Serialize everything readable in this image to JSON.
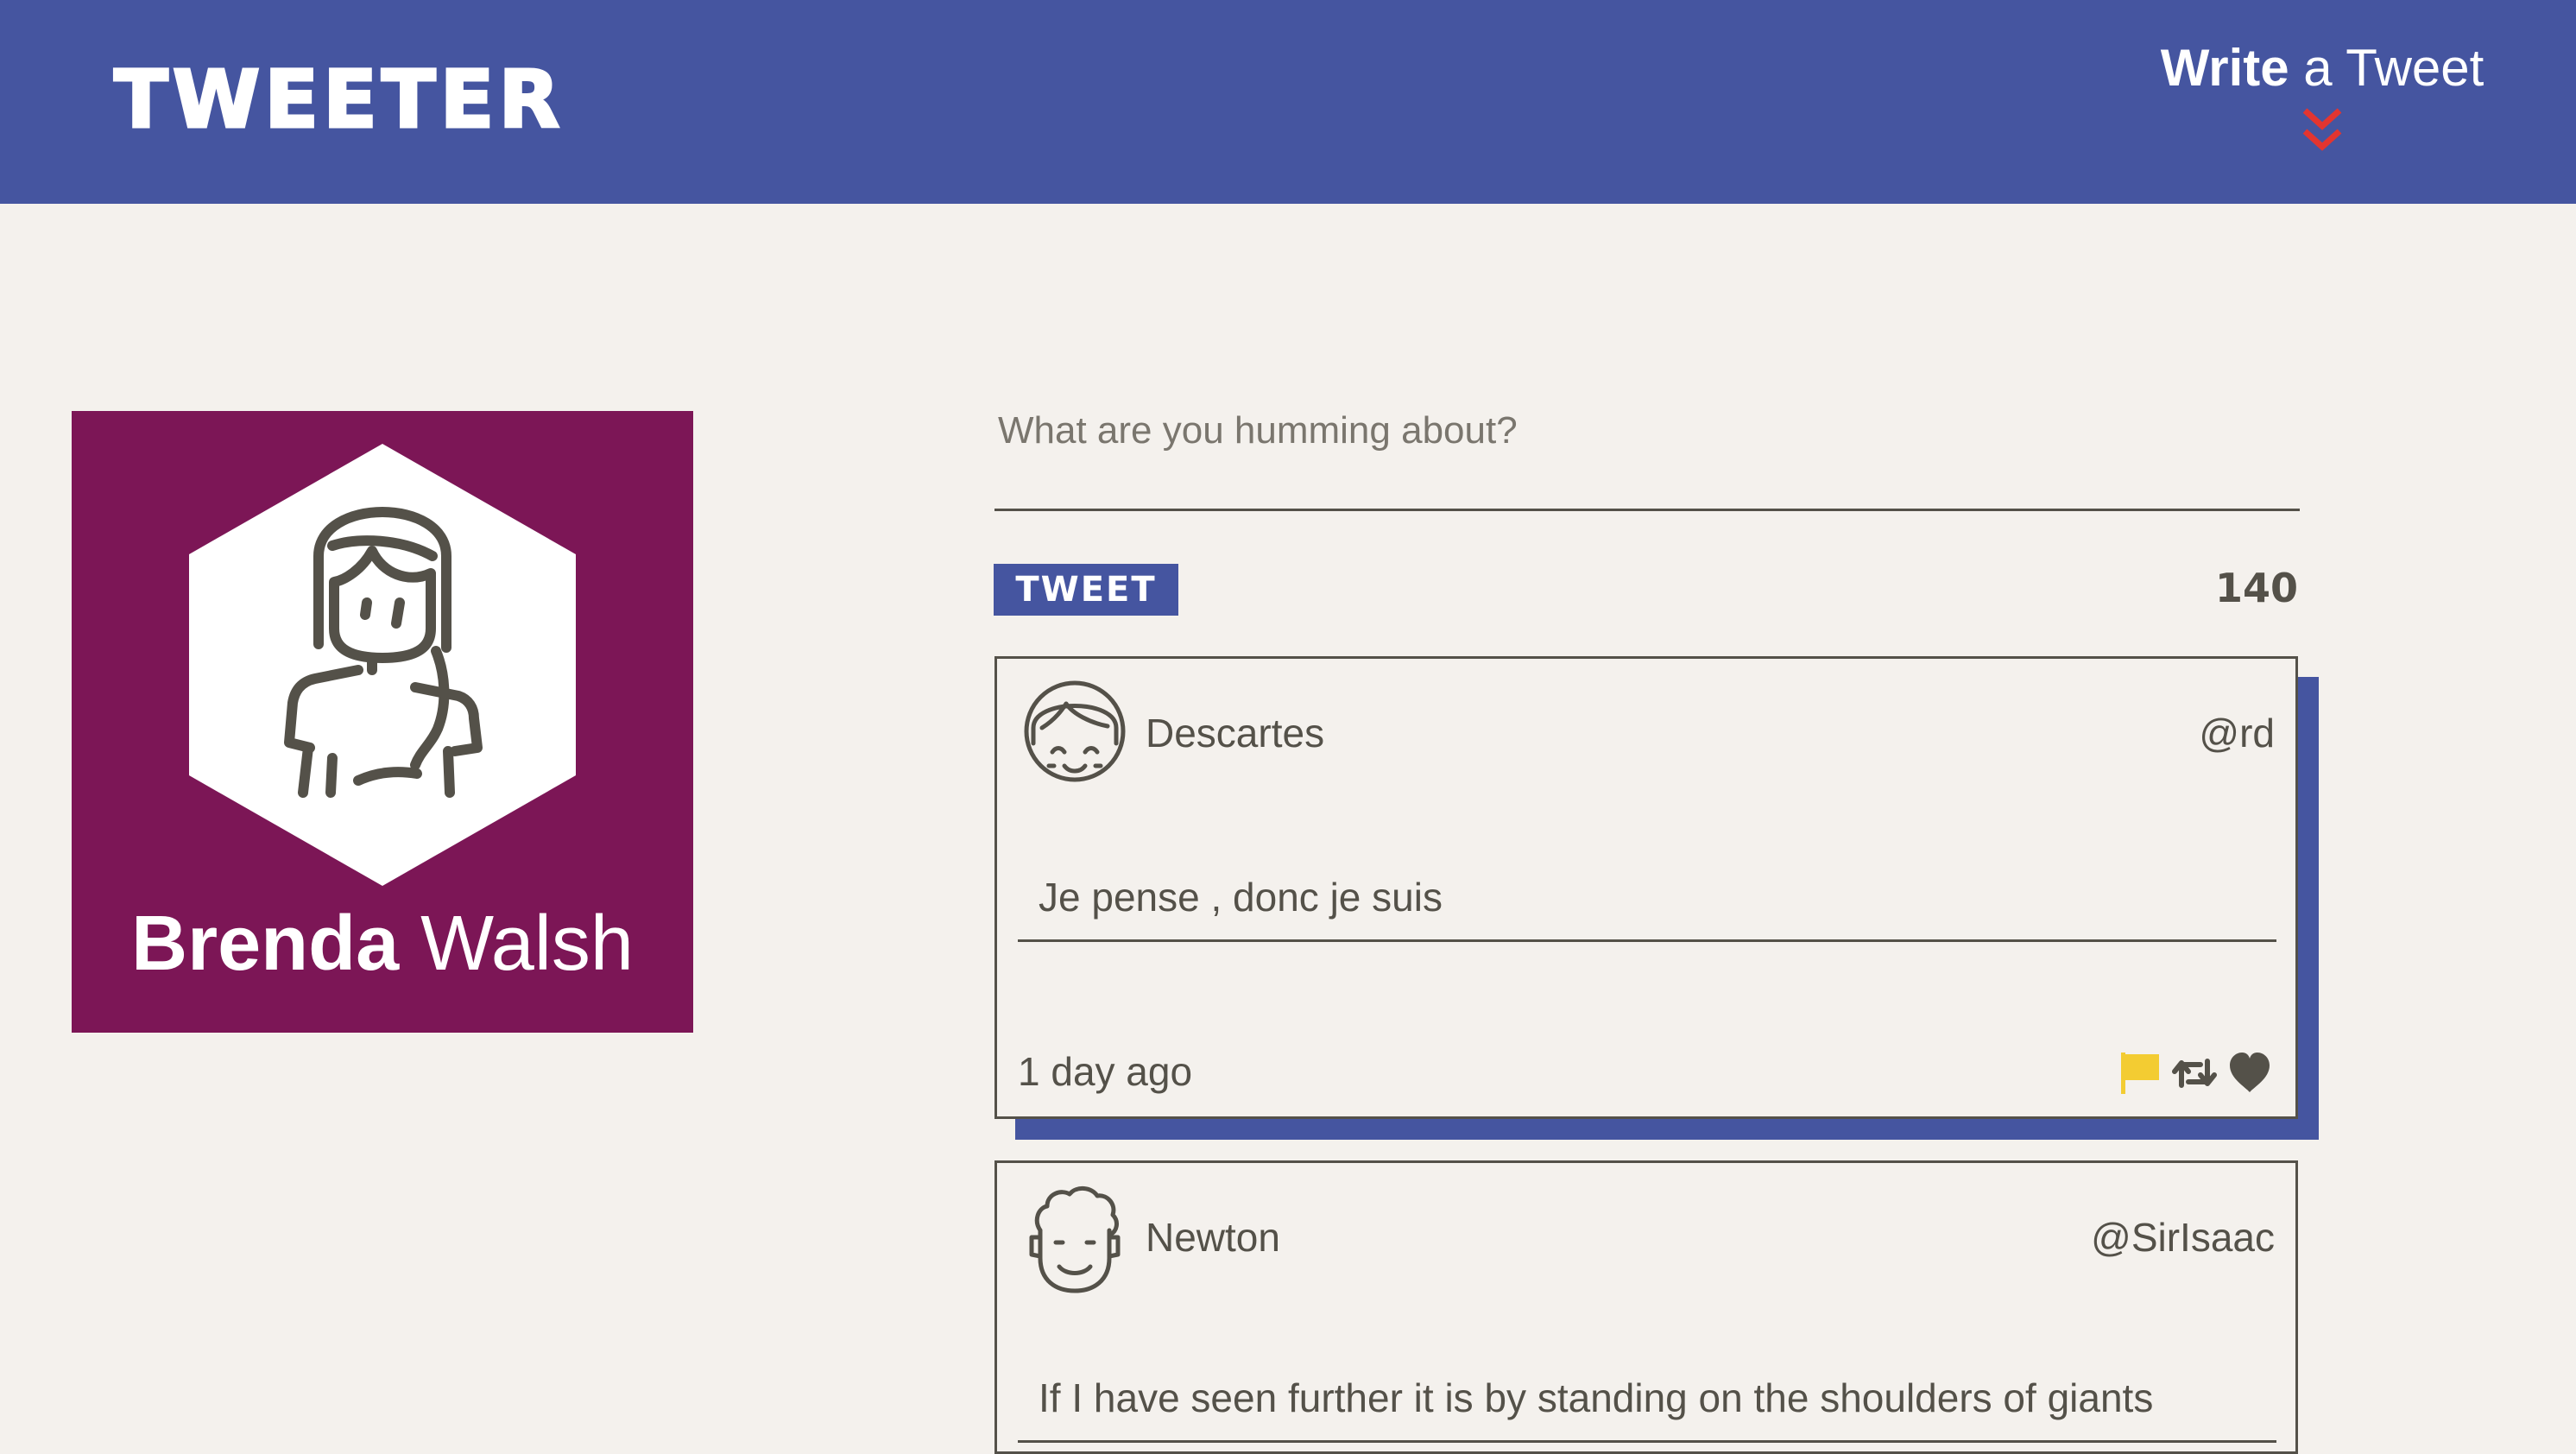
{
  "nav": {
    "logo": "TWEETER",
    "compose_bold": "Write",
    "compose_rest": " a Tweet",
    "chevron_icon": "double-chevron-down-icon",
    "chevron_color": "#e33530"
  },
  "profile": {
    "first_name": "Brenda",
    "last_name": " Walsh",
    "background_color": "#7c1656",
    "avatar_icon": "woman-avatar-icon"
  },
  "composer": {
    "placeholder": "What are you humming about?",
    "value": "",
    "button_label": "TWEET",
    "char_count": "140"
  },
  "tweets": [
    {
      "name": "Descartes",
      "handle": "@rd",
      "text": "Je pense , donc je suis",
      "time": "1 day ago",
      "avatar_icon": "girl-face-avatar-icon",
      "actions": [
        "flag-icon",
        "retweet-icon",
        "heart-icon"
      ]
    },
    {
      "name": "Newton",
      "handle": "@SirIsaac",
      "text": "If I have seen further it is by standing on the shoulders of giants",
      "avatar_icon": "curly-hair-face-avatar-icon"
    }
  ],
  "colors": {
    "primary": "#4555a0",
    "background": "#f4f1ed",
    "text": "#545149",
    "flag": "#f3cc32",
    "accent_red": "#e33530"
  }
}
